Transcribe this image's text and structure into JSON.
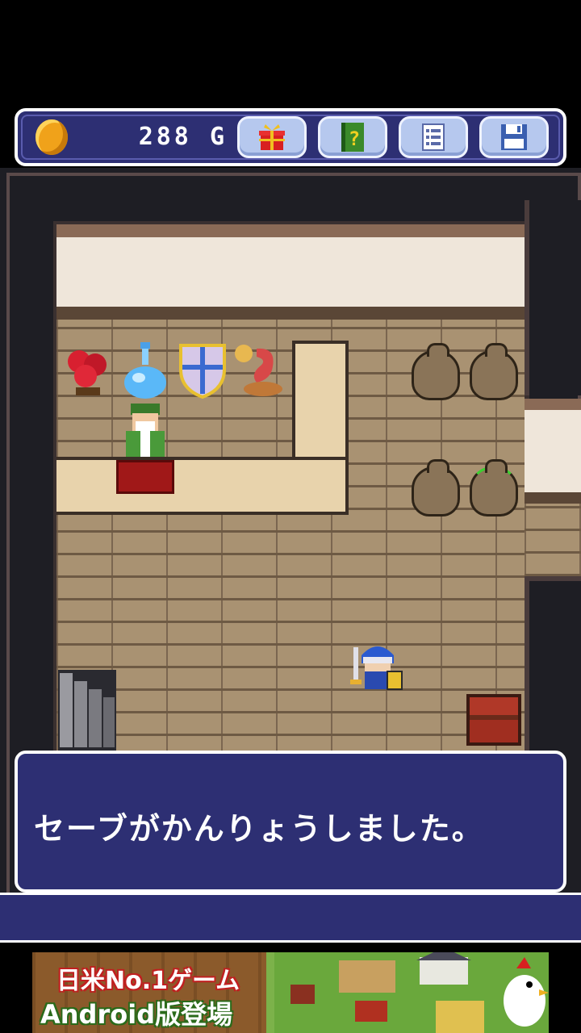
{
  "hud": {
    "gold_amount": "288",
    "gold_unit": "G",
    "buttons": {
      "gift": "gift-icon",
      "help_book": "help-book-icon",
      "menu": "list-icon",
      "save": "floppy-disk-icon"
    }
  },
  "dialog": {
    "message": "セーブがかんりょうしました。"
  },
  "ad": {
    "line1": "日米No.1ゲーム",
    "line2": "Android版登場"
  },
  "colors": {
    "panel": "#2d2f73",
    "panel_border": "#ffffff",
    "hud_button": "#b6c8ee",
    "coin": "#f0a21a"
  }
}
